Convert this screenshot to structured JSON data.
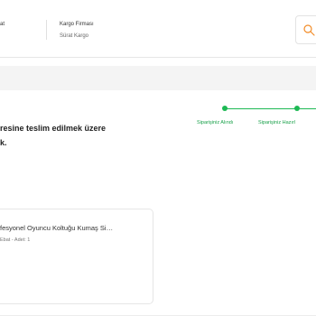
{
  "shipment": {
    "left_label_fragment": "at",
    "cargo_company_label": "Kargo Firması",
    "cargo_company_value": "Sürat Kargo"
  },
  "tracker": {
    "steps": [
      {
        "label": "Siparişiniz Alındı"
      },
      {
        "label": "Siparişiniz Hazırl"
      }
    ],
    "accent_color": "#1db954"
  },
  "delivery": {
    "line1": "resine teslim edilmek üzere",
    "line2": "k."
  },
  "product": {
    "name": "fesyonel Oyuncu Koltuğu Kumaş Si…",
    "meta": "Ebat - Adet: 1"
  }
}
